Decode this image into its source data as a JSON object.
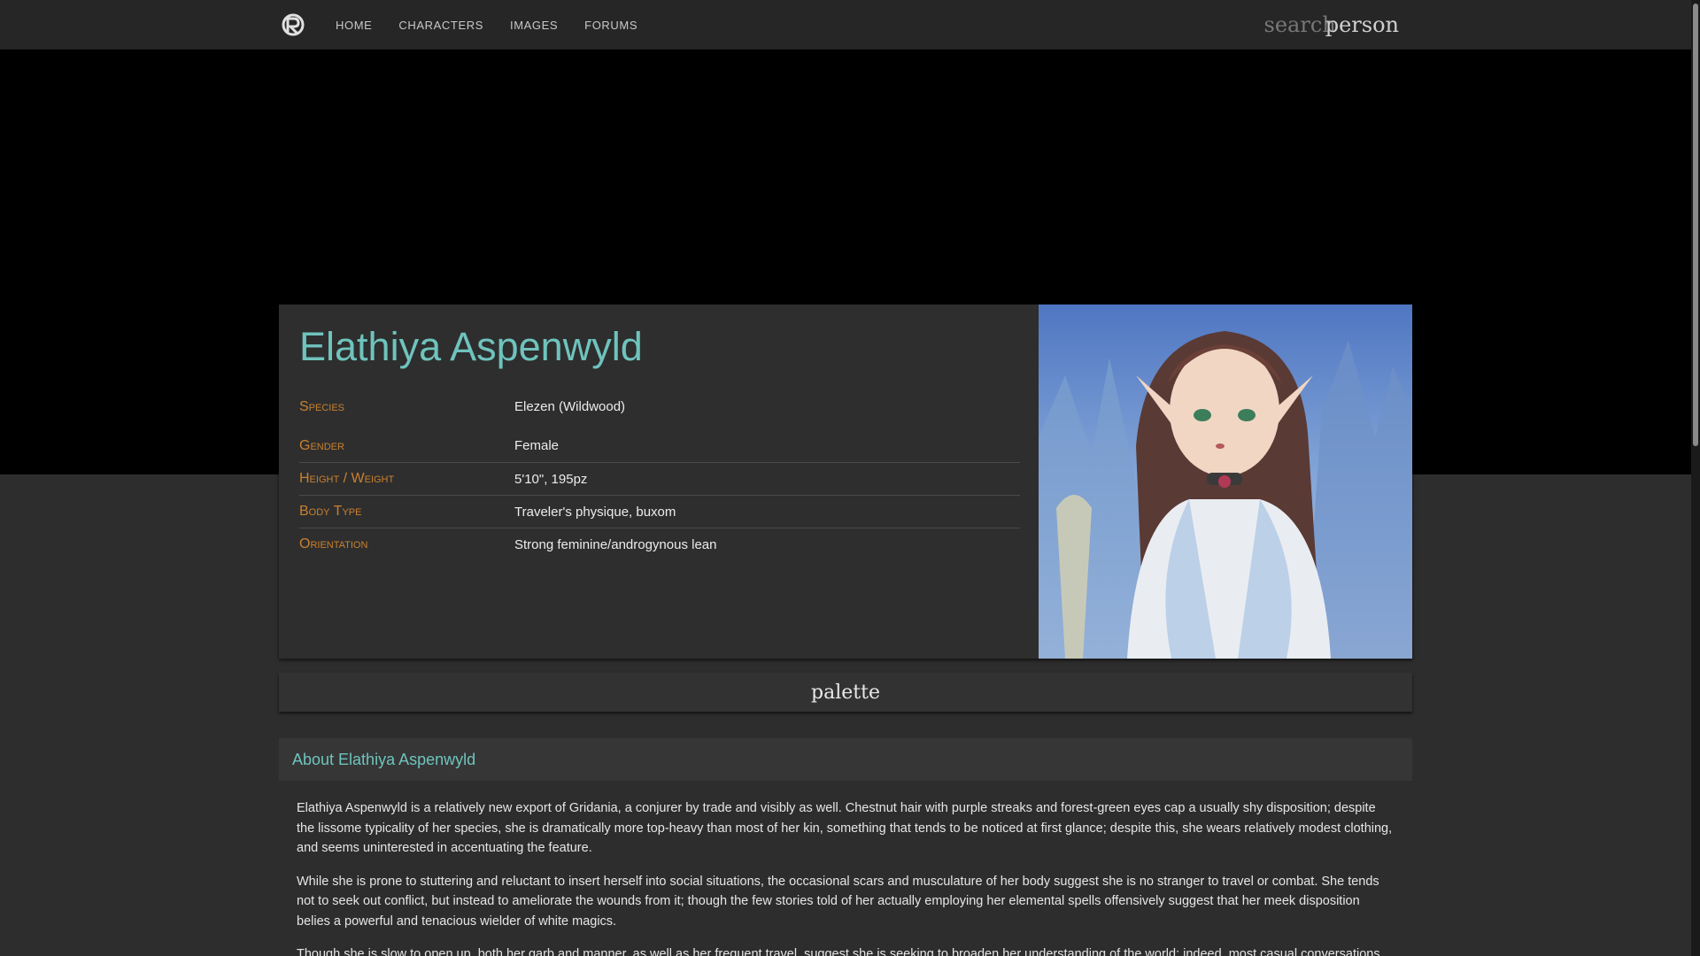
{
  "nav": {
    "logo_icon": "site-logo-icon",
    "links": [
      "HOME",
      "CHARACTERS",
      "IMAGES",
      "FORUMS"
    ],
    "search_label": "search",
    "person_label": "person"
  },
  "profile": {
    "name": "Elathiya Aspenwyld",
    "fields": [
      {
        "label": "Species",
        "value": "Elezen (Wildwood)"
      },
      {
        "label": "Gender",
        "value": "Female"
      },
      {
        "label": "Height / Weight",
        "value": "5'10\", 195pz"
      },
      {
        "label": "Body Type",
        "value": "Traveler's physique, buxom"
      },
      {
        "label": "Orientation",
        "value": "Strong feminine/androgynous lean"
      }
    ]
  },
  "palette_label": "palette",
  "about": {
    "title": "About Elathiya Aspenwyld",
    "paragraphs": [
      "Elathiya Aspenwyld is a relatively new export of Gridania, a conjurer by trade and visibly as well. Chestnut hair with purple streaks and forest-green eyes cap a usually shy disposition; despite the lissome typicality of her species, she is dramatically more top-heavy than most of her kin, something that tends to be noticed at first glance; despite this, she wears relatively modest clothing, and seems uninterested in accentuating the feature.",
      "While she is prone to stuttering and reluctant to insert herself into social situations, the occasional scars and musculature of her body suggest she is no stranger to travel or combat. She tends not to seek out conflict, but instead to ameliorate the wounds from it; though the few stories told of her actually employing her elemental spells offensively suggest that her meek disposition belies a powerful and tenacious wielder of white magics.",
      "Though she is slow to open up, both her garb and manner, as well as her frequent travel, suggest she is seeking to broaden her understanding of the world; indeed, most casual conversations"
    ]
  },
  "colors": {
    "accent_teal": "#6fc3bd",
    "label_orange": "#c9812f",
    "background": "#2d2d2d"
  }
}
